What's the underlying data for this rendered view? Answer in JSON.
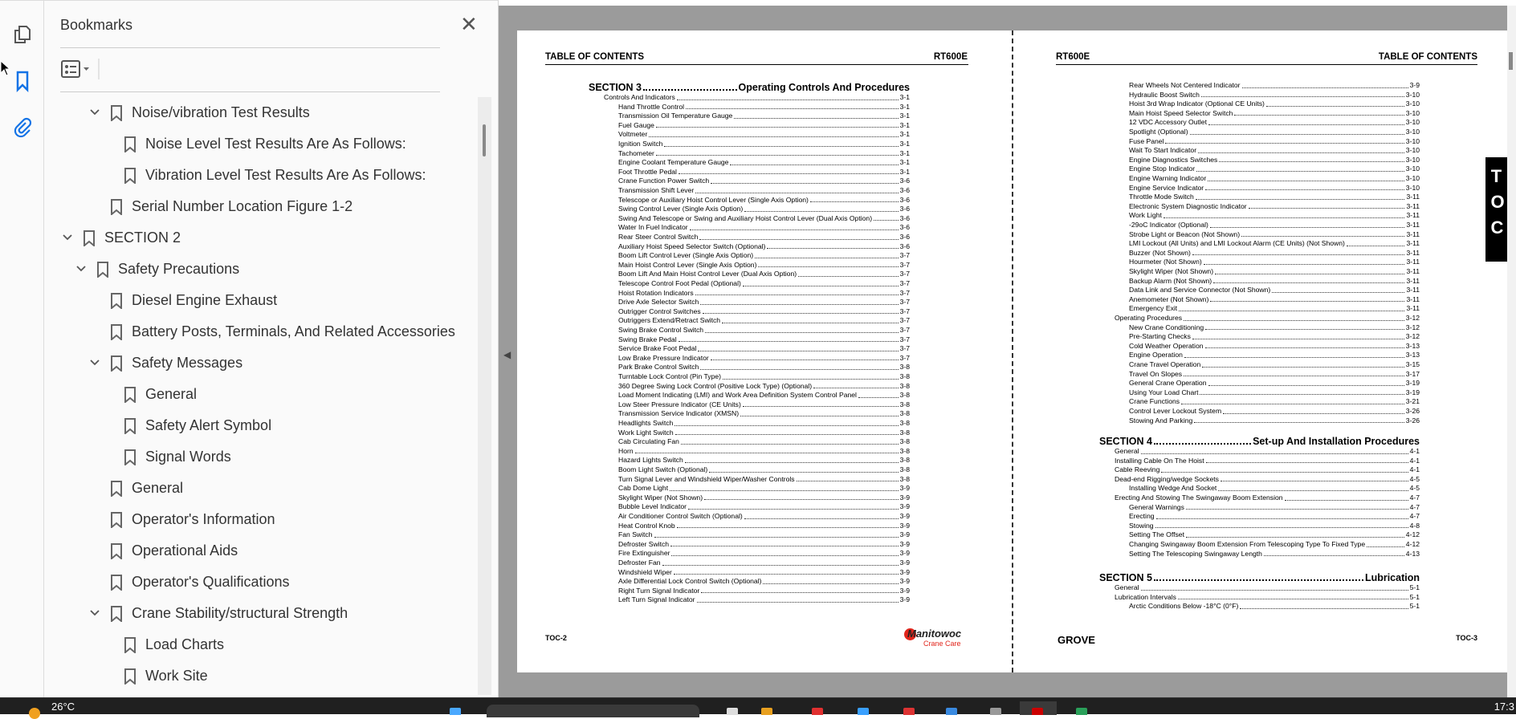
{
  "sidebar": {
    "title": "Bookmarks",
    "close_icon": "close-icon",
    "options_icon": "list-options-icon",
    "items": [
      {
        "label": "Noise/vibration Test Results",
        "level": 2,
        "expanded": true
      },
      {
        "label": "Noise Level Test Results Are As Follows:",
        "level": 3
      },
      {
        "label": "Vibration Level Test Results Are As Follows:",
        "level": 3
      },
      {
        "label": "Serial Number Location Figure 1-2",
        "level": 2
      },
      {
        "label": "SECTION 2",
        "level": 0,
        "expanded": true
      },
      {
        "label": "Safety Precautions",
        "level": 1,
        "expanded": true
      },
      {
        "label": "Diesel Engine Exhaust",
        "level": 2
      },
      {
        "label": "Battery Posts, Terminals, And Related Accessories",
        "level": 2
      },
      {
        "label": "Safety Messages",
        "level": 2,
        "expanded": true
      },
      {
        "label": "General",
        "level": 3
      },
      {
        "label": "Safety Alert Symbol",
        "level": 3
      },
      {
        "label": "Signal Words",
        "level": 3
      },
      {
        "label": "General",
        "level": 2
      },
      {
        "label": "Operator's Information",
        "level": 2
      },
      {
        "label": "Operational Aids",
        "level": 2
      },
      {
        "label": "Operator's Qualifications",
        "level": 2
      },
      {
        "label": "Crane Stability/structural Strength",
        "level": 2,
        "expanded": true
      },
      {
        "label": "Load Charts",
        "level": 3
      },
      {
        "label": "Work Site",
        "level": 3
      }
    ]
  },
  "left_page": {
    "header_left": "TABLE OF CONTENTS",
    "header_right": "RT600E",
    "footer_left": "TOC-2",
    "logo_text": "Manitowoc",
    "logo_sub": "Crane Care",
    "sections": [
      {
        "num": "SECTION 3",
        "title": "Operating Controls And Procedures",
        "entries": [
          [
            "Controls And Indicators",
            "3-1",
            1
          ],
          [
            "Hand Throttle Control",
            "3-1",
            2
          ],
          [
            "Transmission Oil Temperature Gauge",
            "3-1",
            2
          ],
          [
            "Fuel Gauge",
            "3-1",
            2
          ],
          [
            "Voltmeter",
            "3-1",
            2
          ],
          [
            "Ignition Switch",
            "3-1",
            2
          ],
          [
            "Tachometer",
            "3-1",
            2
          ],
          [
            "Engine Coolant Temperature Gauge",
            "3-1",
            2
          ],
          [
            "Foot Throttle Pedal",
            "3-1",
            2
          ],
          [
            "Crane Function Power Switch",
            "3-6",
            2
          ],
          [
            "Transmission Shift Lever",
            "3-6",
            2
          ],
          [
            "Telescope or Auxiliary Hoist Control Lever (Single Axis Option)",
            "3-6",
            2
          ],
          [
            "Swing Control Lever (Single Axis Option)",
            "3-6",
            2
          ],
          [
            "Swing And Telescope or Swing and Auxiliary Hoist Control Lever (Dual Axis Option)",
            "3-6",
            2
          ],
          [
            "Water In Fuel Indicator",
            "3-6",
            2
          ],
          [
            "Rear Steer Control Switch",
            "3-6",
            2
          ],
          [
            "Auxiliary Hoist Speed Selector Switch (Optional)",
            "3-6",
            2
          ],
          [
            "Boom Lift Control Lever (Single Axis Option)",
            "3-7",
            2
          ],
          [
            "Main Hoist Control Lever (Single Axis Option)",
            "3-7",
            2
          ],
          [
            "Boom Lift And Main Hoist Control Lever (Dual Axis Option)",
            "3-7",
            2
          ],
          [
            "Telescope Control Foot Pedal (Optional)",
            "3-7",
            2
          ],
          [
            "Hoist Rotation Indicators",
            "3-7",
            2
          ],
          [
            "Drive Axle Selector Switch",
            "3-7",
            2
          ],
          [
            "Outrigger Control Switches",
            "3-7",
            2
          ],
          [
            "Outriggers Extend/Retract Switch",
            "3-7",
            2
          ],
          [
            "Swing Brake Control Switch",
            "3-7",
            2
          ],
          [
            "Swing Brake Pedal",
            "3-7",
            2
          ],
          [
            "Service Brake Foot Pedal",
            "3-7",
            2
          ],
          [
            "Low Brake Pressure Indicator",
            "3-7",
            2
          ],
          [
            "Park Brake Control Switch",
            "3-8",
            2
          ],
          [
            "Turntable Lock Control (Pin Type)",
            "3-8",
            2
          ],
          [
            "360 Degree Swing Lock Control (Positive Lock Type) (Optional)",
            "3-8",
            2
          ],
          [
            "Load Moment Indicating (LMI) and Work Area Definition System Control Panel",
            "3-8",
            2
          ],
          [
            "Low Steer Pressure Indicator (CE Units)",
            "3-8",
            2
          ],
          [
            "Transmission Service Indicator (XMSN)",
            "3-8",
            2
          ],
          [
            "Headlights Switch",
            "3-8",
            2
          ],
          [
            "Work Light Switch",
            "3-8",
            2
          ],
          [
            "Cab Circulating Fan",
            "3-8",
            2
          ],
          [
            "Horn",
            "3-8",
            2
          ],
          [
            "Hazard Lights Switch",
            "3-8",
            2
          ],
          [
            "Boom Light Switch (Optional)",
            "3-8",
            2
          ],
          [
            "Turn Signal Lever and Windshield Wiper/Washer Controls",
            "3-8",
            2
          ],
          [
            "Cab Dome Light",
            "3-9",
            2
          ],
          [
            "Skylight Wiper (Not Shown)",
            "3-9",
            2
          ],
          [
            "Bubble Level Indicator",
            "3-9",
            2
          ],
          [
            "Air Conditioner Control Switch (Optional)",
            "3-9",
            2
          ],
          [
            "Heat Control Knob",
            "3-9",
            2
          ],
          [
            "Fan Switch",
            "3-9",
            2
          ],
          [
            "Defroster Switch",
            "3-9",
            2
          ],
          [
            "Fire Extinguisher",
            "3-9",
            2
          ],
          [
            "Defroster Fan",
            "3-9",
            2
          ],
          [
            "Windshield Wiper",
            "3-9",
            2
          ],
          [
            "Axle Differential Lock Control Switch (Optional)",
            "3-9",
            2
          ],
          [
            "Right Turn Signal Indicator",
            "3-9",
            2
          ],
          [
            "Left Turn Signal Indicator",
            "3-9",
            2
          ]
        ]
      }
    ]
  },
  "right_page": {
    "header_left": "RT600E",
    "header_right": "TABLE OF CONTENTS",
    "footer_left": "GROVE",
    "footer_right": "TOC-3",
    "side_tab": "TOC",
    "continued": [
      [
        "Rear Wheels Not Centered Indicator",
        "3-9",
        2
      ],
      [
        "Hydraulic Boost Switch",
        "3-10",
        2
      ],
      [
        "Hoist 3rd Wrap Indicator (Optional CE Units)",
        "3-10",
        2
      ],
      [
        "Main Hoist Speed Selector Switch",
        "3-10",
        2
      ],
      [
        "12 VDC Accessory Outlet",
        "3-10",
        2
      ],
      [
        "Spotlight (Optional)",
        "3-10",
        2
      ],
      [
        "Fuse Panel",
        "3-10",
        2
      ],
      [
        "Wait To Start Indicator",
        "3-10",
        2
      ],
      [
        "Engine Diagnostics Switches",
        "3-10",
        2
      ],
      [
        "Engine Stop Indicator",
        "3-10",
        2
      ],
      [
        "Engine Warning Indicator",
        "3-10",
        2
      ],
      [
        "Engine Service Indicator",
        "3-10",
        2
      ],
      [
        "Throttle Mode Switch",
        "3-11",
        2
      ],
      [
        "Electronic System Diagnostic Indicator",
        "3-11",
        2
      ],
      [
        "Work Light",
        "3-11",
        2
      ],
      [
        "-29oC Indicator (Optional)",
        "3-11",
        2
      ],
      [
        "Strobe Light or Beacon (Not Shown)",
        "3-11",
        2
      ],
      [
        "LMI Lockout (All Units) and LMI Lockout Alarm (CE Units) (Not Shown)",
        "3-11",
        2
      ],
      [
        "Buzzer (Not Shown)",
        "3-11",
        2
      ],
      [
        "Hourmeter (Not Shown)",
        "3-11",
        2
      ],
      [
        "Skylight Wiper (Not Shown)",
        "3-11",
        2
      ],
      [
        "Backup Alarm (Not Shown)",
        "3-11",
        2
      ],
      [
        "Data Link and Service Connector (Not Shown)",
        "3-11",
        2
      ],
      [
        "Anemometer (Not Shown)",
        "3-11",
        2
      ],
      [
        "Emergency Exit",
        "3-11",
        2
      ],
      [
        "Operating Procedures",
        "3-12",
        1
      ],
      [
        "New Crane Conditioning",
        "3-12",
        2
      ],
      [
        "Pre-Starting Checks",
        "3-12",
        2
      ],
      [
        "Cold Weather Operation",
        "3-13",
        2
      ],
      [
        "Engine Operation",
        "3-13",
        2
      ],
      [
        "Crane Travel Operation",
        "3-15",
        2
      ],
      [
        "Travel On Slopes",
        "3-17",
        2
      ],
      [
        "General Crane Operation",
        "3-19",
        2
      ],
      [
        "Using Your Load Chart",
        "3-19",
        2
      ],
      [
        "Crane Functions",
        "3-21",
        2
      ],
      [
        "Control Lever Lockout System",
        "3-26",
        2
      ],
      [
        "Stowing And Parking",
        "3-26",
        2
      ]
    ],
    "sections": [
      {
        "num": "SECTION 4",
        "title": "Set-up And Installation Procedures",
        "entries": [
          [
            "General",
            "4-1",
            1
          ],
          [
            "Installing Cable On The Hoist",
            "4-1",
            1
          ],
          [
            "Cable Reeving",
            "4-1",
            1
          ],
          [
            "Dead-end Rigging/wedge Sockets",
            "4-5",
            1
          ],
          [
            "Installing Wedge And Socket",
            "4-5",
            2
          ],
          [
            "Erecting And Stowing The Swingaway Boom Extension",
            "4-7",
            1
          ],
          [
            "General Warnings",
            "4-7",
            2
          ],
          [
            "Erecting",
            "4-7",
            2
          ],
          [
            "Stowing",
            "4-8",
            2
          ],
          [
            "Setting The Offset",
            "4-12",
            2
          ],
          [
            "Changing Swingaway Boom Extension From Telescoping Type To Fixed Type",
            "4-12",
            2
          ],
          [
            "Setting The Telescoping Swingaway Length",
            "4-13",
            2
          ]
        ]
      },
      {
        "num": "SECTION 5",
        "title": "Lubrication",
        "entries": [
          [
            "General",
            "5-1",
            1
          ],
          [
            "Lubrication Intervals",
            "5-1",
            1
          ],
          [
            "Arctic Conditions Below -18°C (0°F)",
            "5-1",
            2
          ]
        ]
      }
    ]
  },
  "taskbar": {
    "weather": "26°C",
    "clock": "17:3"
  },
  "colors": {
    "accent": "#1473e6",
    "viewer_bg": "#9b9b9b",
    "logo_red": "#e1251b"
  }
}
